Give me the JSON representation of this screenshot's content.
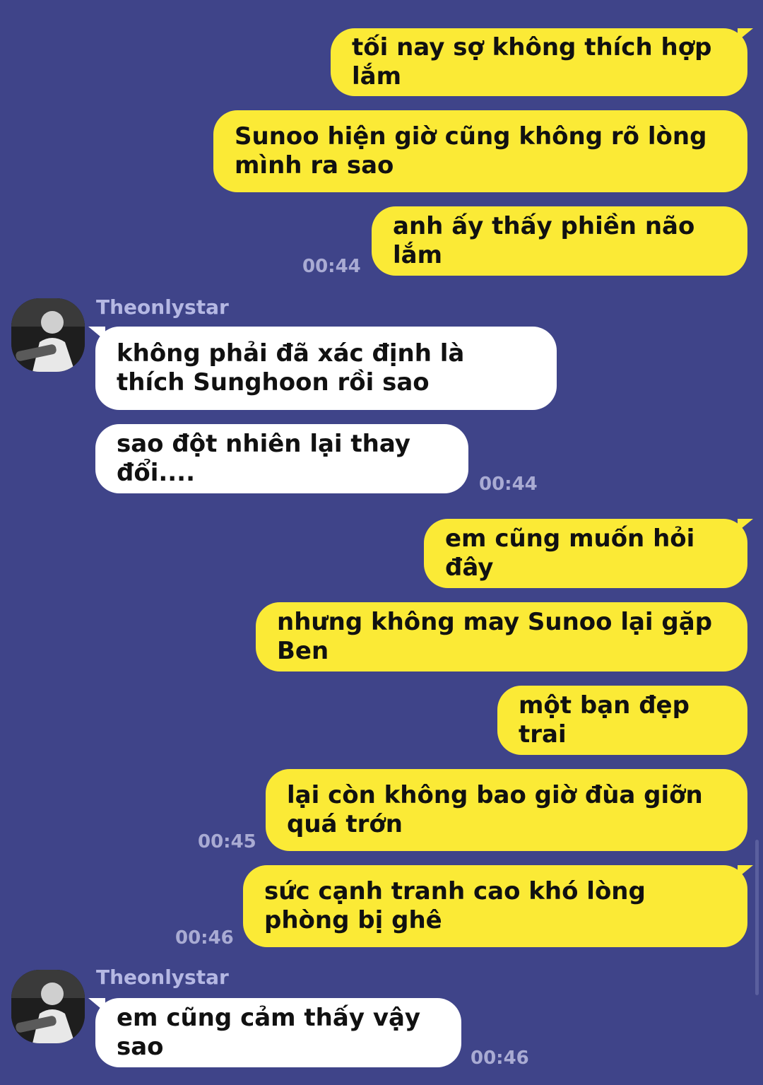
{
  "contact": {
    "name": "Theonlystar"
  },
  "messages": [
    {
      "text": "tối nay sợ không thích hợp lắm"
    },
    {
      "text": "Sunoo hiện giờ cũng không rõ lòng mình ra sao"
    },
    {
      "text": "anh ấy thấy phiền não lắm"
    },
    {
      "text": "không phải đã xác định là thích Sunghoon rồi sao"
    },
    {
      "text": "sao đột nhiên lại thay đổi...."
    },
    {
      "text": "em cũng muốn hỏi đây"
    },
    {
      "text": "nhưng không may Sunoo lại gặp Ben"
    },
    {
      "text": "một bạn đẹp trai"
    },
    {
      "text": "lại còn không bao giờ đùa giỡn quá trớn"
    },
    {
      "text": "sức cạnh tranh cao khó lòng phòng bị ghê"
    },
    {
      "text": "em cũng cảm thấy vậy sao"
    }
  ],
  "timestamps": [
    "00:44",
    "00:44",
    "00:45",
    "00:46",
    "00:46"
  ],
  "colors": {
    "background": "#3f4489",
    "outgoing": "#fbea36",
    "incoming": "#ffffff",
    "meta": "#a9abd3"
  }
}
